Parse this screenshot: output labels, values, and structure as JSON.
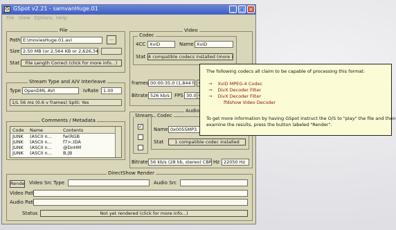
{
  "window": {
    "title": "GSpot v2.21 - samvanHuge.01",
    "minimize": "_",
    "maximize": "□",
    "close": "×",
    "app_icon": "G"
  },
  "menu": [
    "File",
    "View",
    "Options",
    "Help"
  ],
  "file": {
    "title": "File",
    "path_label": "Path",
    "path_value": "E:\\moviesHuge.01.avi",
    "browse_label": "...",
    "size_label": "Size",
    "size_value": "2.50 MB (or 2,564 KB or 2,626,34",
    "size_extra": "",
    "stat_label": "Stat",
    "stat_value": "File Length Correct (click for more info...)"
  },
  "stream": {
    "title": "Stream Type and A/V Interleave",
    "type_label": "Type",
    "type_value": "OpenDML AVI",
    "ivrate_label": "IvRate",
    "ivrate_value": "1.00",
    "ivdesc": "1/L 56 ms (0.6 v frames) Split: Yes"
  },
  "comments": {
    "title": "Comments / Metadata",
    "columns": [
      "Code",
      "Name",
      "Contents"
    ],
    "rows": [
      [
        "JUNK",
        "(ASCII n...",
        "fw(RGB"
      ],
      [
        "JUNK",
        "(ASCII n...",
        "f7>,)DA"
      ],
      [
        "JUNK",
        "(ASCII n...",
        "@DnHM"
      ],
      [
        "JUNK",
        "(ASCII n...",
        "B,|B"
      ]
    ]
  },
  "video": {
    "title": "Video",
    "codec_title": "Codec",
    "fourcc_label": "4CC",
    "fourcc_value": "XviD",
    "name_label": "Name",
    "name_value": "XviD",
    "stat_label": "Stat",
    "stat_value": "4 compatible codecs installed (more info...)",
    "frames_label": "frames",
    "frames_value": "00:00:35.0 (1,844 fr)",
    "frames_extra": "Q",
    "bitrate_label": "Bitrate",
    "bitrate_value": "526 kb/s",
    "fps_label": "FPS",
    "fps_value": "30.00",
    "fps_extra": "Q"
  },
  "audio": {
    "title": "Audio",
    "stream_label": "Stream",
    "codec_title": "Codec",
    "name_label": "Name",
    "name_value": "0x0055MP3",
    "stat_label": "Stat",
    "stat_value": "1 compatible codec installed",
    "bitrate_label": "Bitrate",
    "bitrate_value": "56 kb/s (28 kb, stereo) CBR",
    "hz_label": "Hz",
    "hz_value": "22050 Hz",
    "checks": [
      "✓",
      "",
      ""
    ]
  },
  "directshow": {
    "title": "DirectShow Render",
    "render_button": "Render",
    "video_src_label": "Video Src Type",
    "audio_src_label": "Audio Src",
    "video_path_label": "Video Path",
    "audio_path_label": "Audio Path",
    "status_label": "Status",
    "status_value": "Not yet rendered (click for more info...)"
  },
  "tooltip": {
    "intro": "The following codecs all claim to be capable of processing this format:",
    "codecs": [
      "XviD MPEG-4 Codec",
      "DivX Decoder Filter",
      "DivX Decoder Filter",
      "ffdshow Video Decoder"
    ],
    "arrow": "→",
    "note_1": "To get more information by having GSpot instruct the O/S to \"play\" the file and then",
    "note_2": "examine the results, press the button labeled \"Render\"."
  },
  "colors": {
    "titlebar": "#3d5cc4",
    "window_bg": "#d9d6b9",
    "tooltip_bg": "#fbfbd6",
    "codec_red": "#8a1010"
  }
}
